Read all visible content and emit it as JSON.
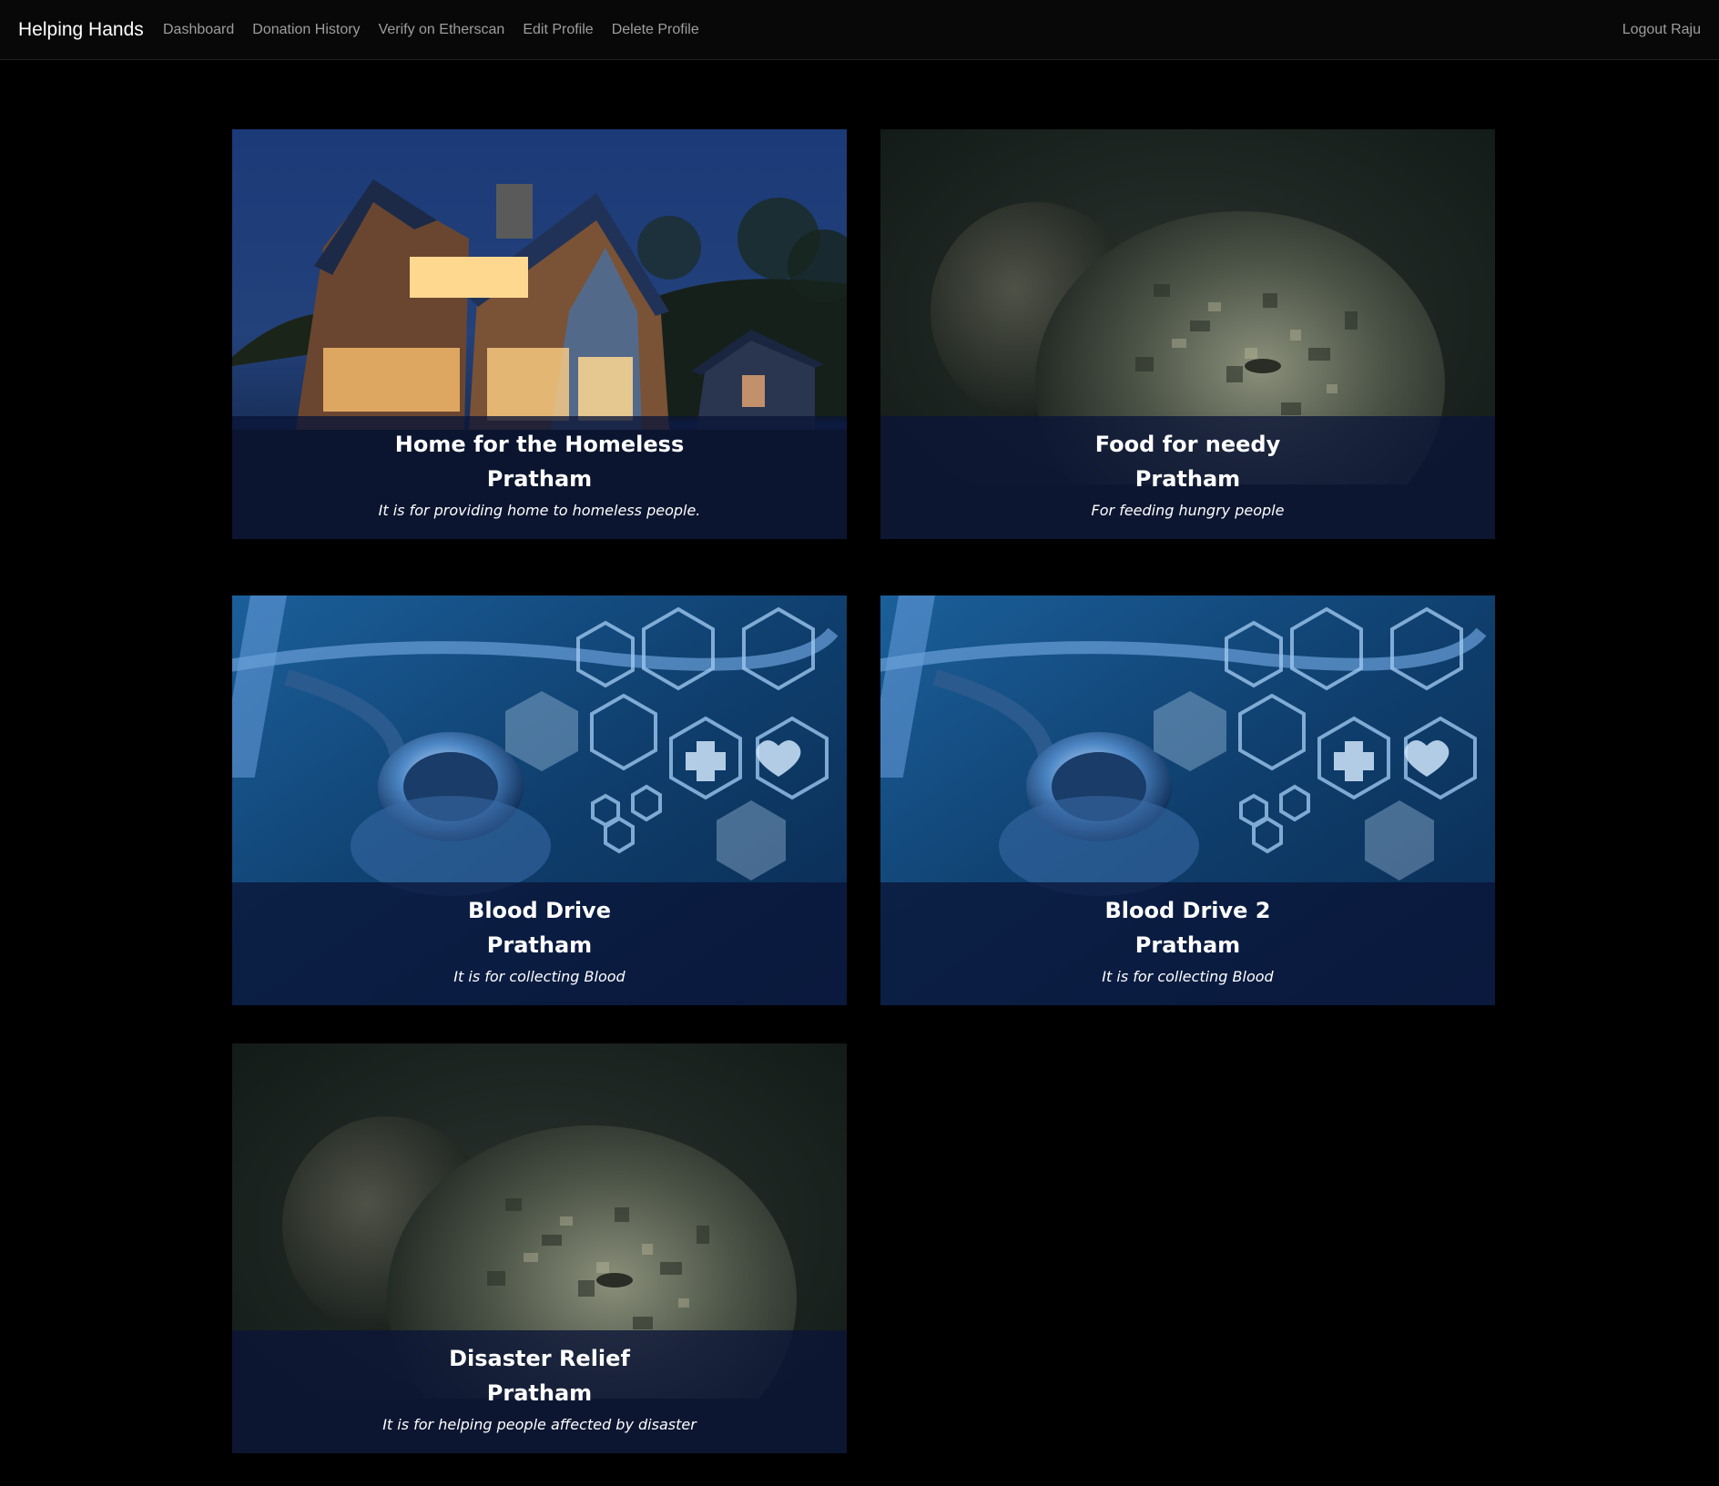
{
  "navbar": {
    "brand": "Helping Hands",
    "links": [
      {
        "label": "Dashboard"
      },
      {
        "label": "Donation History"
      },
      {
        "label": "Verify on Etherscan"
      },
      {
        "label": "Edit Profile"
      },
      {
        "label": "Delete Profile"
      }
    ],
    "logout": "Logout Raju"
  },
  "campaigns": [
    {
      "title": "Home for the Homeless",
      "organization": "Pratham",
      "description": "It is for providing home to homeless people.",
      "image": "house-at-night-image"
    },
    {
      "title": "Food for needy",
      "organization": "Pratham",
      "description": "For feeding hungry people",
      "image": "military-helmet-image"
    },
    {
      "title": "Blood Drive",
      "organization": "Pratham",
      "description": "It is for collecting Blood",
      "image": "stethoscope-medical-icons-image"
    },
    {
      "title": "Blood Drive 2",
      "organization": "Pratham",
      "description": "It is for collecting Blood",
      "image": "stethoscope-medical-icons-image"
    },
    {
      "title": "Disaster Relief",
      "organization": "Pratham",
      "description": "It is for helping people affected by disaster",
      "image": "military-helmet-image"
    }
  ],
  "colors": {
    "background": "#000000",
    "navbar": "#080808",
    "nav_link": "#9d9d9d",
    "caption_overlay": "#0a1437"
  }
}
